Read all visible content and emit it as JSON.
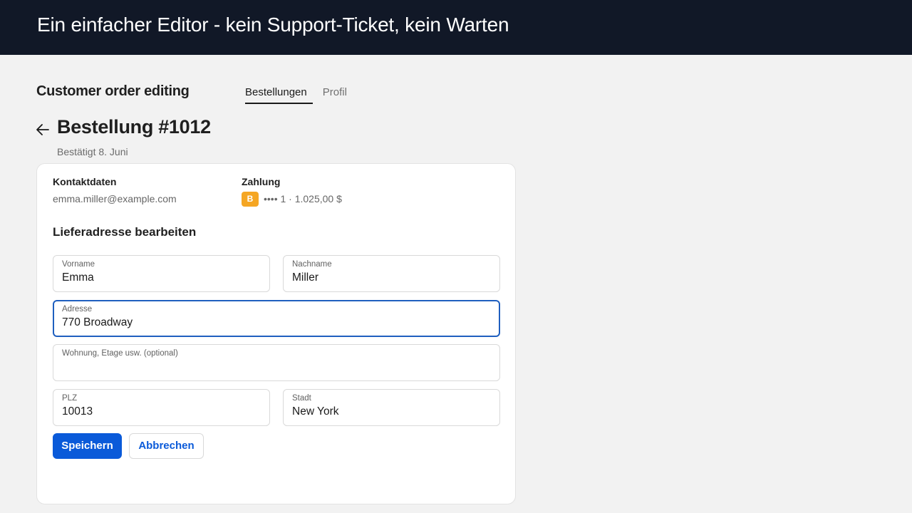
{
  "banner": {
    "title": "Ein einfacher Editor - kein Support-Ticket, kein Warten"
  },
  "app": {
    "title": "Customer order editing"
  },
  "tabs": [
    {
      "label": "Bestellungen",
      "active": true
    },
    {
      "label": "Profil",
      "active": false
    }
  ],
  "order": {
    "title": "Bestellung #1012",
    "subtitle": "Bestätigt 8. Juni"
  },
  "contact": {
    "label": "Kontaktdaten",
    "email": "emma.miller@example.com"
  },
  "payment": {
    "label": "Zahlung",
    "badge": "B",
    "details": "•••• 1 · 1.025,00 $",
    "badge_color": "#f5a623"
  },
  "form": {
    "title": "Lieferadresse bearbeiten",
    "first_name": {
      "label": "Vorname",
      "value": "Emma"
    },
    "last_name": {
      "label": "Nachname",
      "value": "Miller"
    },
    "address": {
      "label": "Adresse",
      "value": "770 Broadway"
    },
    "apartment": {
      "label": "Wohnung, Etage usw. (optional)",
      "value": ""
    },
    "zip": {
      "label": "PLZ",
      "value": "10013"
    },
    "city": {
      "label": "Stadt",
      "value": "New York"
    },
    "save_label": "Speichern",
    "cancel_label": "Abbrechen"
  },
  "colors": {
    "banner_bg": "#111827",
    "accent": "#0a5ad9",
    "focus": "#1f5fbf"
  },
  "icons": {
    "back": "arrow-left-icon"
  }
}
